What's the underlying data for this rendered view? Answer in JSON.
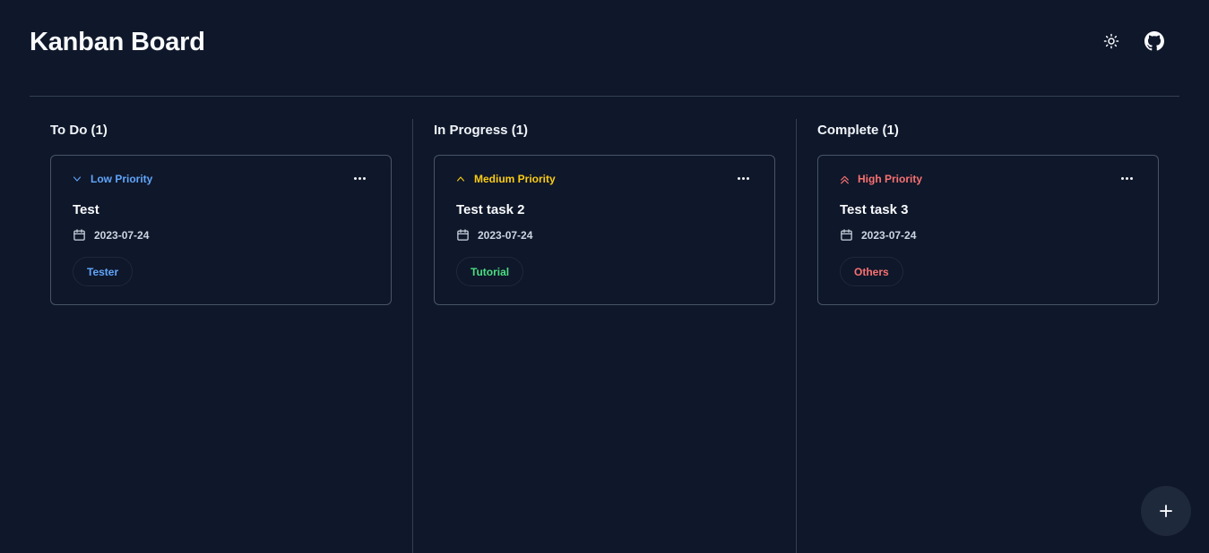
{
  "header": {
    "title": "Kanban Board",
    "theme_icon": "sun-icon",
    "github_icon": "github-icon"
  },
  "columns": [
    {
      "title": "To Do (1)",
      "cards": [
        {
          "priority": "Low Priority",
          "priority_icon": "chevron-down-icon",
          "priority_color": "#60a5fa",
          "title": "Test",
          "date": "2023-07-24",
          "tag": "Tester",
          "tag_color": "#60a5fa"
        }
      ]
    },
    {
      "title": "In Progress (1)",
      "cards": [
        {
          "priority": "Medium Priority",
          "priority_icon": "chevron-up-icon",
          "priority_color": "#facc15",
          "title": "Test task 2",
          "date": "2023-07-24",
          "tag": "Tutorial",
          "tag_color": "#4ade80"
        }
      ]
    },
    {
      "title": "Complete (1)",
      "cards": [
        {
          "priority": "High Priority",
          "priority_icon": "chevrons-up-icon",
          "priority_color": "#f87171",
          "title": "Test task 3",
          "date": "2023-07-24",
          "tag": "Others",
          "tag_color": "#f87171"
        }
      ]
    }
  ],
  "fab": {
    "icon": "plus-icon"
  },
  "colors": {
    "background": "#0f172a",
    "border": "#475569",
    "divider": "#334155"
  }
}
